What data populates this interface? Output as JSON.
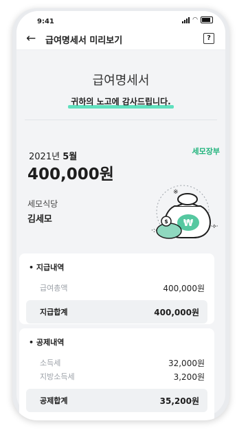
{
  "status": {
    "time": "9:41"
  },
  "appbar": {
    "back_icon": "←",
    "title": "급여명세서 미리보기",
    "help_icon": "?"
  },
  "headline": {
    "title": "급여명세서",
    "subtitle": "귀하의 노고에 감사드립니다."
  },
  "summary": {
    "year": "2021년",
    "month": "5월",
    "brand": "세모장부",
    "amount": "400,000원",
    "store": "세모식당",
    "employee": "김세모"
  },
  "payment": {
    "section": "지급내역",
    "rows": [
      {
        "label": "급여총액",
        "value": "400,000원"
      }
    ],
    "total_label": "지급합계",
    "total_value": "400,000원"
  },
  "deduction": {
    "section": "공제내역",
    "rows": [
      {
        "label": "소득세",
        "value": "32,000원"
      },
      {
        "label": "지방소득세",
        "value": "3,200원"
      }
    ],
    "total_label": "공제합계",
    "total_value": "35,200원"
  },
  "colors": {
    "accent": "#22b47d",
    "highlight": "#5fe0be",
    "background": "#f3f4f6"
  }
}
